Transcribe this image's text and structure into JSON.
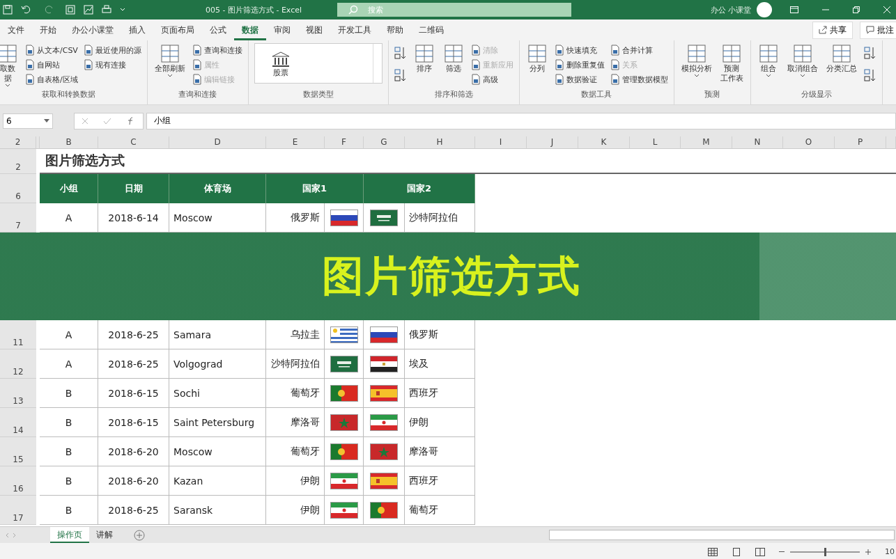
{
  "title_bar": {
    "title": "005 - 图片筛选方式 - Excel",
    "search": {
      "placeholder": "搜索"
    },
    "user": "办公 小课堂"
  },
  "ribbon_tabs": [
    {
      "label": "文件",
      "selected": false
    },
    {
      "label": "开始",
      "selected": false
    },
    {
      "label": "办公小课堂",
      "selected": false
    },
    {
      "label": "插入",
      "selected": false
    },
    {
      "label": "页面布局",
      "selected": false
    },
    {
      "label": "公式",
      "selected": false
    },
    {
      "label": "数据",
      "selected": true
    },
    {
      "label": "审阅",
      "selected": false
    },
    {
      "label": "视图",
      "selected": false
    },
    {
      "label": "开发工具",
      "selected": false
    },
    {
      "label": "帮助",
      "selected": false
    },
    {
      "label": "二维码",
      "selected": false
    }
  ],
  "share_button": "共享",
  "comments_button": "批注",
  "ribbon_groups": [
    {
      "label": "获取和转换数据",
      "columns": [
        [
          {
            "kind": "large",
            "lines": [
              "取数",
              "据"
            ],
            "caret": true,
            "disabled": false
          }
        ],
        [
          {
            "kind": "small",
            "label": "从文本/CSV",
            "disabled": false
          },
          {
            "kind": "small",
            "label": "自网站",
            "disabled": false
          },
          {
            "kind": "small",
            "label": "自表格/区域",
            "disabled": false
          }
        ],
        [
          {
            "kind": "small",
            "label": "最近使用的源",
            "disabled": false
          },
          {
            "kind": "small",
            "label": "现有连接",
            "disabled": false
          }
        ]
      ]
    },
    {
      "label": "查询和连接",
      "columns": [
        [
          {
            "kind": "large",
            "lines": [
              "全部刷新"
            ],
            "caret": true,
            "disabled": false
          }
        ],
        [
          {
            "kind": "small",
            "label": "查询和连接",
            "disabled": false
          },
          {
            "kind": "small",
            "label": "属性",
            "disabled": true
          },
          {
            "kind": "small",
            "label": "编辑链接",
            "disabled": true
          }
        ]
      ]
    },
    {
      "label": "数据类型",
      "columns": [
        [
          {
            "kind": "gallery",
            "lines": [
              "股票"
            ],
            "disabled": false
          }
        ]
      ]
    },
    {
      "label": "排序和筛选",
      "columns": [
        [
          {
            "kind": "icon",
            "disabled": false
          },
          {
            "kind": "icon",
            "disabled": false
          }
        ],
        [
          {
            "kind": "large",
            "lines": [
              "排序"
            ],
            "caret": false,
            "disabled": false
          }
        ],
        [
          {
            "kind": "large",
            "lines": [
              "筛选"
            ],
            "caret": false,
            "disabled": false
          }
        ],
        [
          {
            "kind": "small",
            "label": "清除",
            "disabled": true
          },
          {
            "kind": "small",
            "label": "重新应用",
            "disabled": true
          },
          {
            "kind": "small",
            "label": "高级",
            "disabled": false
          }
        ]
      ]
    },
    {
      "label": "数据工具",
      "columns": [
        [
          {
            "kind": "large",
            "lines": [
              "分列"
            ],
            "caret": false,
            "disabled": false
          }
        ],
        [
          {
            "kind": "small",
            "label": "快速填充",
            "disabled": false
          },
          {
            "kind": "small",
            "label": "删除重复值",
            "disabled": false
          },
          {
            "kind": "small",
            "label": "数据验证",
            "disabled": false
          }
        ],
        [
          {
            "kind": "small",
            "label": "合并计算",
            "disabled": false
          },
          {
            "kind": "small",
            "label": "关系",
            "disabled": true
          },
          {
            "kind": "small",
            "label": "管理数据模型",
            "disabled": false
          }
        ]
      ]
    },
    {
      "label": "预测",
      "columns": [
        [
          {
            "kind": "large",
            "lines": [
              "模拟分析"
            ],
            "caret": true,
            "disabled": false
          }
        ],
        [
          {
            "kind": "large",
            "lines": [
              "预测",
              "工作表"
            ],
            "caret": false,
            "disabled": false
          }
        ]
      ]
    },
    {
      "label": "分级显示",
      "columns": [
        [
          {
            "kind": "large",
            "lines": [
              "组合"
            ],
            "caret": true,
            "disabled": false
          }
        ],
        [
          {
            "kind": "large",
            "lines": [
              "取消组合"
            ],
            "caret": true,
            "disabled": false
          }
        ],
        [
          {
            "kind": "large",
            "lines": [
              "分类汇总"
            ],
            "caret": false,
            "disabled": false
          }
        ],
        [
          {
            "kind": "icon",
            "disabled": false
          },
          {
            "kind": "icon",
            "disabled": false
          }
        ]
      ]
    }
  ],
  "formula_bar": {
    "name_box": "6",
    "value": "小组"
  },
  "outline_level": "2",
  "columns": [
    "B",
    "C",
    "D",
    "E",
    "F",
    "G",
    "H",
    "I",
    "J",
    "K",
    "L",
    "M",
    "N",
    "O",
    "P"
  ],
  "sheet_title": {
    "row": "2",
    "text": "图片筛选方式"
  },
  "table": {
    "row": "6",
    "headers": [
      "小组",
      "日期",
      "体育场",
      "国家1",
      "国家2"
    ],
    "rows": [
      {
        "row": "7",
        "group": "A",
        "date": "2018-6-14",
        "venue": "Moscow",
        "team1": {
          "name": "俄罗斯",
          "kind": "ru"
        },
        "team2": {
          "name": "沙特阿拉伯",
          "kind": "sa"
        }
      },
      {
        "row": "11",
        "group": "A",
        "date": "2018-6-25",
        "venue": "Samara",
        "team1": {
          "name": "乌拉圭",
          "kind": "uy"
        },
        "team2": {
          "name": "俄罗斯",
          "kind": "ru"
        }
      },
      {
        "row": "12",
        "group": "A",
        "date": "2018-6-25",
        "venue": "Volgograd",
        "team1": {
          "name": "沙特阿拉伯",
          "kind": "sa"
        },
        "team2": {
          "name": "埃及",
          "kind": "eg"
        }
      },
      {
        "row": "13",
        "group": "B",
        "date": "2018-6-15",
        "venue": "Sochi",
        "team1": {
          "name": "葡萄牙",
          "kind": "pt"
        },
        "team2": {
          "name": "西班牙",
          "kind": "es"
        }
      },
      {
        "row": "14",
        "group": "B",
        "date": "2018-6-15",
        "venue": "Saint Petersburg",
        "team1": {
          "name": "摩洛哥",
          "kind": "ma"
        },
        "team2": {
          "name": "伊朗",
          "kind": "ir"
        }
      },
      {
        "row": "15",
        "group": "B",
        "date": "2018-6-20",
        "venue": "Moscow",
        "team1": {
          "name": "葡萄牙",
          "kind": "pt"
        },
        "team2": {
          "name": "摩洛哥",
          "kind": "ma"
        }
      },
      {
        "row": "16",
        "group": "B",
        "date": "2018-6-20",
        "venue": "Kazan",
        "team1": {
          "name": "伊朗",
          "kind": "ir"
        },
        "team2": {
          "name": "西班牙",
          "kind": "es"
        }
      },
      {
        "row": "17",
        "group": "B",
        "date": "2018-6-25",
        "venue": "Saransk",
        "team1": {
          "name": "伊朗",
          "kind": "ir"
        },
        "team2": {
          "name": "葡萄牙",
          "kind": "pt"
        }
      }
    ]
  },
  "banner": {
    "text": "图片筛选方式"
  },
  "sheet_tabs": [
    {
      "label": "操作页",
      "selected": true
    },
    {
      "label": "讲解",
      "selected": false
    }
  ],
  "zoom": {
    "level": 0.5,
    "reading": "10"
  }
}
